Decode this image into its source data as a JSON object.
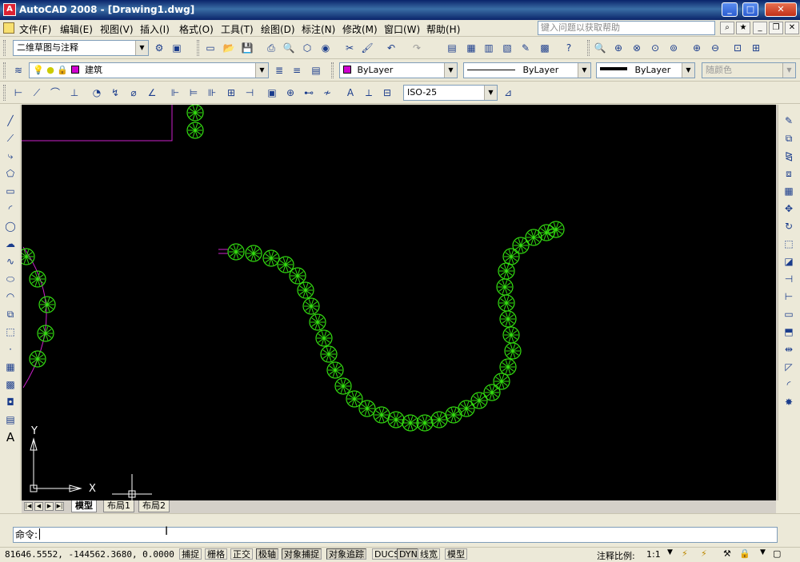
{
  "window": {
    "title": "AutoCAD 2008 - [Drawing1.dwg]",
    "app_icon_letter": "A"
  },
  "menu": [
    "文件(F)",
    "编辑(E)",
    "视图(V)",
    "插入(I)",
    "格式(O)",
    "工具(T)",
    "绘图(D)",
    "标注(N)",
    "修改(M)",
    "窗口(W)",
    "帮助(H)"
  ],
  "help_search": {
    "placeholder": "键入问题以获取帮助"
  },
  "toolbar": {
    "workspace": "二维草图与注释",
    "layer": "建筑",
    "color": "ByLayer",
    "linetype": "ByLayer",
    "lineweight": "ByLayer",
    "plotstyle": "随颜色",
    "dimstyle": "ISO-25"
  },
  "canvas": {
    "ucs_y_label": "Y",
    "ucs_x_label": "X"
  },
  "tabs": [
    "模型",
    "布局1",
    "布局2"
  ],
  "command": {
    "prompt": "命令:"
  },
  "status": {
    "coords": "81646.5552,  -144562.3680, 0.0000",
    "buttons": [
      "捕捉",
      "栅格",
      "正交",
      "极轴",
      "对象捕捉",
      "对象追踪",
      "DUCS",
      "DYN",
      "线宽",
      "模型"
    ],
    "annotation_scale_label": "注释比例:",
    "annotation_scale_value": "1:1"
  },
  "colors": {
    "canvas_bg": "#000000",
    "tree_green": "#33dd11",
    "boundary_magenta": "#cc22cc"
  }
}
